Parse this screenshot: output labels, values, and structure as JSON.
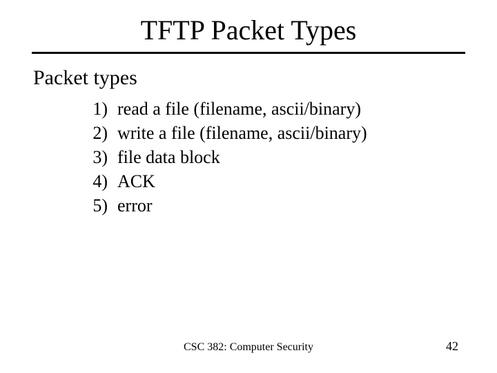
{
  "title": "TFTP Packet Types",
  "subtitle": "Packet types",
  "items": [
    {
      "num": "1)",
      "text": "read a file (filename, ascii/binary)"
    },
    {
      "num": "2)",
      "text": "write a file (filename, ascii/binary)"
    },
    {
      "num": "3)",
      "text": "file data block"
    },
    {
      "num": "4)",
      "text": "ACK"
    },
    {
      "num": "5)",
      "text": "error"
    }
  ],
  "footer": {
    "course": "CSC 382: Computer Security",
    "page": "42"
  }
}
